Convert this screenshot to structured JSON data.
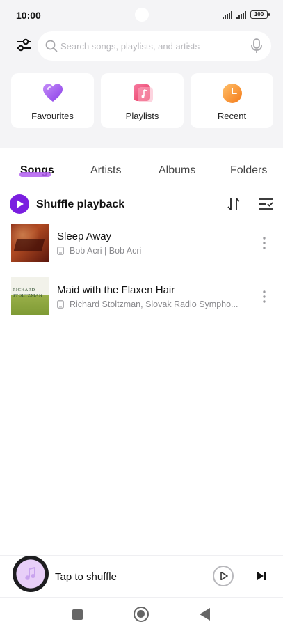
{
  "status": {
    "time": "10:00",
    "battery": "100"
  },
  "search": {
    "placeholder": "Search songs, playlists, and artists"
  },
  "quick_access": [
    {
      "label": "Favourites",
      "icon": "heart-icon",
      "color": "#a35cf0"
    },
    {
      "label": "Playlists",
      "icon": "playlist-icon",
      "color": "#f0527a"
    },
    {
      "label": "Recent",
      "icon": "clock-icon",
      "color": "#f79a2a"
    }
  ],
  "tabs": [
    {
      "label": "Songs",
      "active": true
    },
    {
      "label": "Artists",
      "active": false
    },
    {
      "label": "Albums",
      "active": false
    },
    {
      "label": "Folders",
      "active": false
    }
  ],
  "shuffle": {
    "label": "Shuffle playback"
  },
  "songs": [
    {
      "title": "Sleep Away",
      "subtitle": "Bob Acri | Bob Acri"
    },
    {
      "title": "Maid with the Flaxen Hair",
      "subtitle": "Richard Stoltzman, Slovak Radio Sympho...",
      "art_text_1": "RICHARD",
      "art_text_2": "STOLTZMAN"
    }
  ],
  "mini_player": {
    "label": "Tap to shuffle"
  },
  "colors": {
    "accent": "#7a1ee0",
    "tab_underline": "#b25ef0"
  }
}
